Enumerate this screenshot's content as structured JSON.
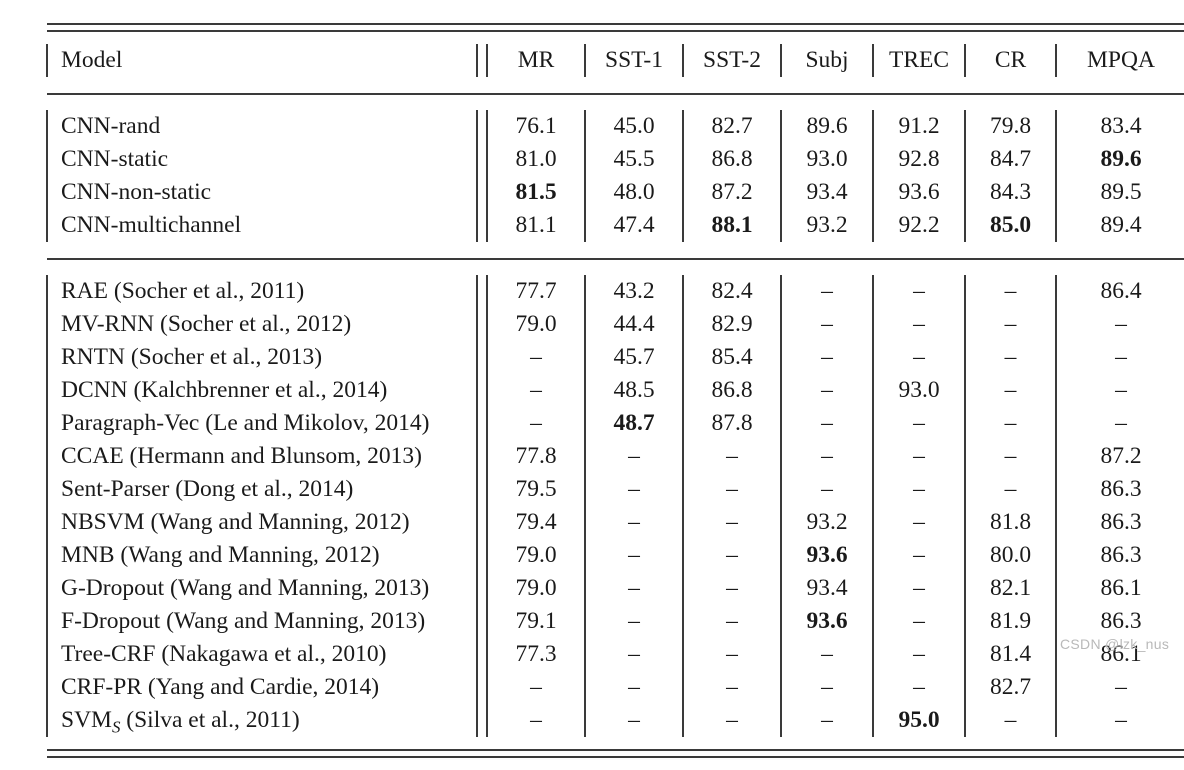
{
  "table": {
    "columns": [
      "Model",
      "MR",
      "SST-1",
      "SST-2",
      "Subj",
      "TREC",
      "CR",
      "MPQA"
    ],
    "header": {
      "model": "Model",
      "mr": "MR",
      "sst1": "SST-1",
      "sst2": "SST-2",
      "subj": "Subj",
      "trec": "TREC",
      "cr": "CR",
      "mpqa": "MPQA"
    },
    "dash": "–",
    "section_cnn": [
      {
        "model": "CNN-rand",
        "model_sub": "",
        "mr": "76.1",
        "sst1": "45.0",
        "sst2": "82.7",
        "subj": "89.6",
        "trec": "91.2",
        "cr": "79.8",
        "mpqa": "83.4",
        "bold": []
      },
      {
        "model": "CNN-static",
        "model_sub": "",
        "mr": "81.0",
        "sst1": "45.5",
        "sst2": "86.8",
        "subj": "93.0",
        "trec": "92.8",
        "cr": "84.7",
        "mpqa": "89.6",
        "bold": [
          "mpqa"
        ]
      },
      {
        "model": "CNN-non-static",
        "model_sub": "",
        "mr": "81.5",
        "sst1": "48.0",
        "sst2": "87.2",
        "subj": "93.4",
        "trec": "93.6",
        "cr": "84.3",
        "mpqa": "89.5",
        "bold": [
          "mr"
        ]
      },
      {
        "model": "CNN-multichannel",
        "model_sub": "",
        "mr": "81.1",
        "sst1": "47.4",
        "sst2": "88.1",
        "subj": "93.2",
        "trec": "92.2",
        "cr": "85.0",
        "mpqa": "89.4",
        "bold": [
          "sst2",
          "cr"
        ]
      }
    ],
    "section_baselines": [
      {
        "model": "RAE (Socher et al., 2011)",
        "model_sub": "",
        "mr": "77.7",
        "sst1": "43.2",
        "sst2": "82.4",
        "subj": "–",
        "trec": "–",
        "cr": "–",
        "mpqa": "86.4",
        "bold": []
      },
      {
        "model": "MV-RNN (Socher et al., 2012)",
        "model_sub": "",
        "mr": "79.0",
        "sst1": "44.4",
        "sst2": "82.9",
        "subj": "–",
        "trec": "–",
        "cr": "–",
        "mpqa": "–",
        "bold": []
      },
      {
        "model": "RNTN (Socher et al., 2013)",
        "model_sub": "",
        "mr": "–",
        "sst1": "45.7",
        "sst2": "85.4",
        "subj": "–",
        "trec": "–",
        "cr": "–",
        "mpqa": "–",
        "bold": []
      },
      {
        "model": "DCNN (Kalchbrenner et al., 2014)",
        "model_sub": "",
        "mr": "–",
        "sst1": "48.5",
        "sst2": "86.8",
        "subj": "–",
        "trec": "93.0",
        "cr": "–",
        "mpqa": "–",
        "bold": []
      },
      {
        "model": "Paragraph-Vec (Le and Mikolov, 2014)",
        "model_sub": "",
        "mr": "–",
        "sst1": "48.7",
        "sst2": "87.8",
        "subj": "–",
        "trec": "–",
        "cr": "–",
        "mpqa": "–",
        "bold": [
          "sst1"
        ]
      },
      {
        "model": "CCAE (Hermann and Blunsom, 2013)",
        "model_sub": "",
        "mr": "77.8",
        "sst1": "–",
        "sst2": "–",
        "subj": "–",
        "trec": "–",
        "cr": "–",
        "mpqa": "87.2",
        "bold": []
      },
      {
        "model": "Sent-Parser (Dong et al., 2014)",
        "model_sub": "",
        "mr": "79.5",
        "sst1": "–",
        "sst2": "–",
        "subj": "–",
        "trec": "–",
        "cr": "–",
        "mpqa": "86.3",
        "bold": []
      },
      {
        "model": "NBSVM (Wang and Manning, 2012)",
        "model_sub": "",
        "mr": "79.4",
        "sst1": "–",
        "sst2": "–",
        "subj": "93.2",
        "trec": "–",
        "cr": "81.8",
        "mpqa": "86.3",
        "bold": []
      },
      {
        "model": "MNB (Wang and Manning, 2012)",
        "model_sub": "",
        "mr": "79.0",
        "sst1": "–",
        "sst2": "–",
        "subj": "93.6",
        "trec": "–",
        "cr": "80.0",
        "mpqa": "86.3",
        "bold": [
          "subj"
        ]
      },
      {
        "model": "G-Dropout (Wang and Manning, 2013)",
        "model_sub": "",
        "mr": "79.0",
        "sst1": "–",
        "sst2": "–",
        "subj": "93.4",
        "trec": "–",
        "cr": "82.1",
        "mpqa": "86.1",
        "bold": []
      },
      {
        "model": "F-Dropout (Wang and Manning, 2013)",
        "model_sub": "",
        "mr": "79.1",
        "sst1": "–",
        "sst2": "–",
        "subj": "93.6",
        "trec": "–",
        "cr": "81.9",
        "mpqa": "86.3",
        "bold": [
          "subj"
        ]
      },
      {
        "model": "Tree-CRF (Nakagawa et al., 2010)",
        "model_sub": "",
        "mr": "77.3",
        "sst1": "–",
        "sst2": "–",
        "subj": "–",
        "trec": "–",
        "cr": "81.4",
        "mpqa": "86.1",
        "bold": []
      },
      {
        "model": "CRF-PR (Yang and Cardie, 2014)",
        "model_sub": "",
        "mr": "–",
        "sst1": "–",
        "sst2": "–",
        "subj": "–",
        "trec": "–",
        "cr": "82.7",
        "mpqa": "–",
        "bold": []
      },
      {
        "model": "SVM",
        "model_sub": "S",
        "model_tail": " (Silva et al., 2011)",
        "mr": "–",
        "sst1": "–",
        "sst2": "–",
        "subj": "–",
        "trec": "95.0",
        "cr": "–",
        "mpqa": "–",
        "bold": [
          "trec"
        ]
      }
    ]
  },
  "watermark": {
    "text": "CSDN @lzk_nus"
  }
}
